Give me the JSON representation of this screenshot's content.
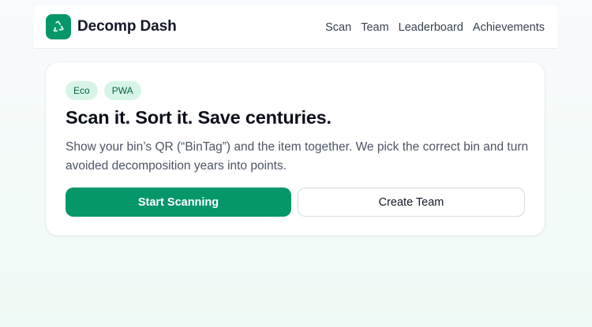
{
  "header": {
    "brand": "Decomp Dash",
    "logo_icon": "recycle-icon",
    "nav": [
      {
        "label": "Scan"
      },
      {
        "label": "Team"
      },
      {
        "label": "Leaderboard"
      },
      {
        "label": "Achievements"
      }
    ]
  },
  "hero": {
    "chips": [
      "Eco",
      "PWA"
    ],
    "title": "Scan it. Sort it. Save centuries.",
    "description": "Show your bin’s QR (“BinTag”) and the item together. We pick the correct bin and turn avoided decomposition years into points.",
    "primary_button": "Start Scanning",
    "secondary_button": "Create Team"
  },
  "colors": {
    "accent": "#059669",
    "chip_bg": "#d7f5e6",
    "chip_text": "#065f46"
  }
}
